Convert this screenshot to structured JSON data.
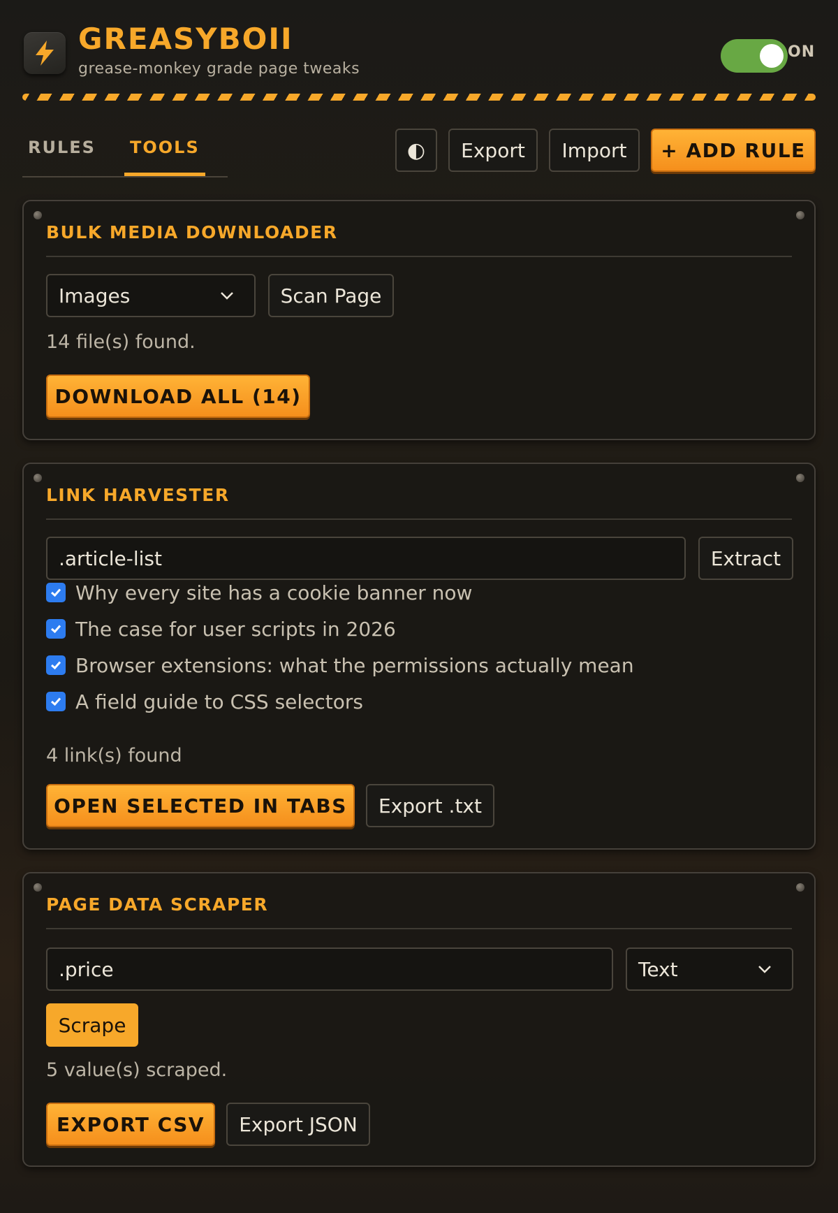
{
  "app": {
    "title": "GREASYBOII",
    "subtitle": "grease-monkey grade page tweaks",
    "toggle_label": "ON",
    "toggle_on": true,
    "accent": "#f7a82a",
    "toggle_color": "#68a844",
    "logo_icon": "lightning-bolt-icon"
  },
  "tabs": [
    {
      "label": "RULES",
      "active": false
    },
    {
      "label": "TOOLS",
      "active": true
    }
  ],
  "toolbar": {
    "theme_icon": "contrast-icon",
    "theme_glyph": "◐",
    "export_label": "Export",
    "import_label": "Import",
    "add_rule_label": "+ ADD RULE"
  },
  "bulk_media": {
    "title": "BULK MEDIA DOWNLOADER",
    "type_select": "Images",
    "scan_label": "Scan Page",
    "status": "14 file(s) found.",
    "download_label": "DOWNLOAD ALL (14)"
  },
  "link_harvester": {
    "title": "LINK HARVESTER",
    "selector_value": ".article-list",
    "extract_label": "Extract",
    "links": [
      {
        "label": "Why every site has a cookie banner now",
        "checked": true
      },
      {
        "label": "The case for user scripts in 2026",
        "checked": true
      },
      {
        "label": "Browser extensions: what the permissions actually mean",
        "checked": true
      },
      {
        "label": "A field guide to CSS selectors",
        "checked": true
      }
    ],
    "status": "4 link(s) found",
    "open_label": "OPEN SELECTED IN TABS",
    "export_label": "Export .txt"
  },
  "scraper": {
    "title": "PAGE DATA SCRAPER",
    "selector_value": ".price",
    "mode_select": "Text",
    "scrape_label": "Scrape",
    "status": "5 value(s) scraped.",
    "csv_label": "EXPORT CSV",
    "json_label": "Export JSON"
  }
}
